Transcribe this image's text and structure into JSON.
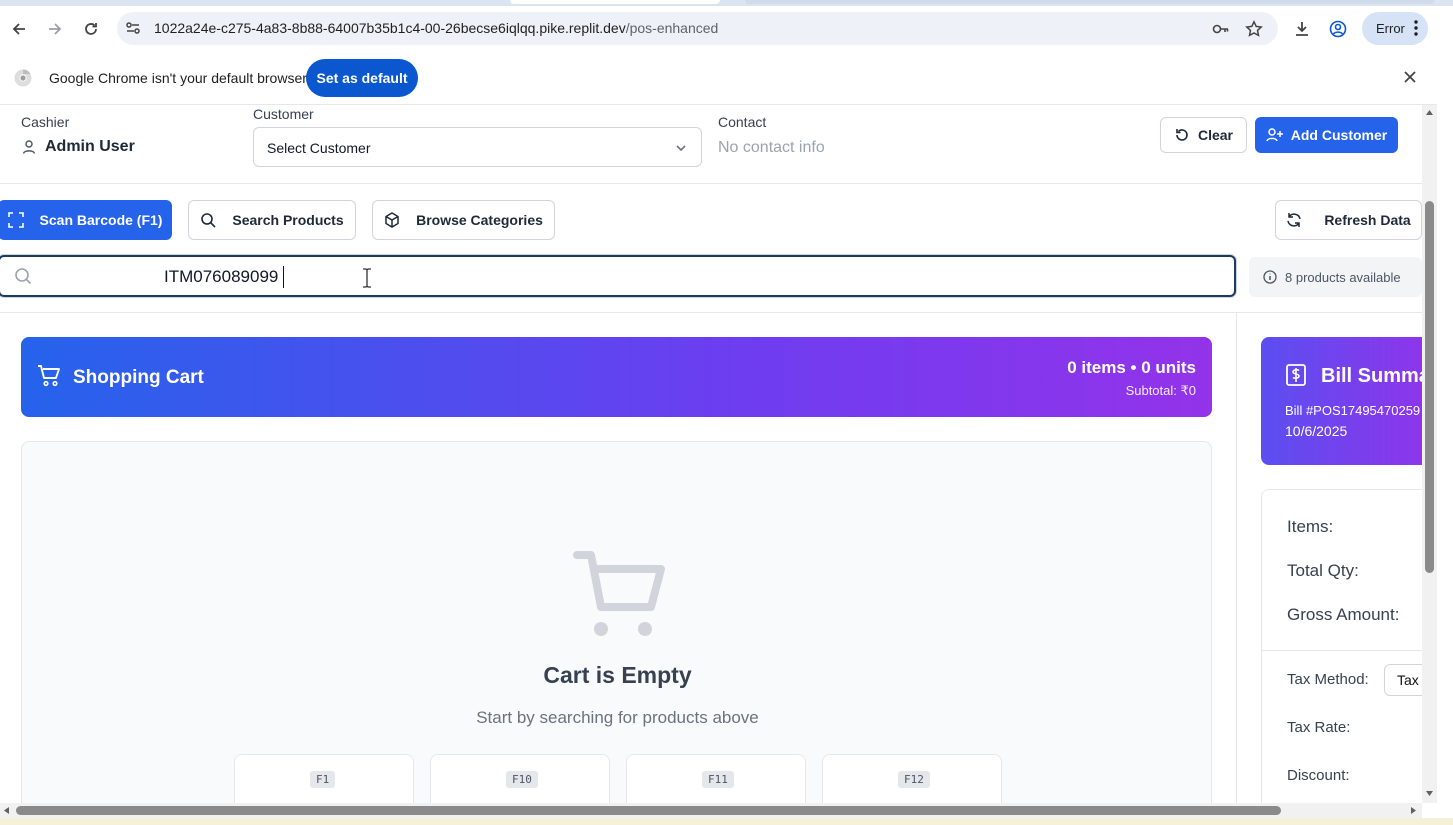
{
  "browser": {
    "url_host": "1022a24e-c275-4a83-8b88-64007b35b1c4-00-26becse6iqlqq.pike.replit.dev",
    "url_path": "/pos-enhanced",
    "profile_chip": "Error",
    "infobar_message": "Google Chrome isn't your default browser",
    "infobar_button": "Set as default"
  },
  "header": {
    "cashier_label": "Cashier",
    "cashier_name": "Admin User",
    "customer_label": "Customer",
    "customer_select_value": "Select Customer",
    "contact_label": "Contact",
    "contact_value": "No contact info",
    "clear_label": "Clear",
    "add_customer_label": "Add Customer"
  },
  "toolbar": {
    "scan_label": "Scan Barcode (F1)",
    "search_label": "Search Products",
    "browse_label": "Browse Categories",
    "refresh_label": "Refresh Data"
  },
  "search": {
    "value": "ITM076089099",
    "products_available": "8 products available"
  },
  "cart": {
    "title": "Shopping Cart",
    "counts": "0 items • 0 units",
    "subtotal": "Subtotal: ₹0",
    "empty_title": "Cart is Empty",
    "empty_subtitle": "Start by searching for products above",
    "shortcut_keys": [
      "F1",
      "F10",
      "F11",
      "F12"
    ]
  },
  "bill": {
    "title": "Bill Summa",
    "bill_number": "Bill #POS17495470259",
    "date": "10/6/2025",
    "items_label": "Items:",
    "total_qty_label": "Total Qty:",
    "gross_amount_label": "Gross Amount:",
    "tax_method_label": "Tax Method:",
    "tax_method_value": "Tax I",
    "tax_rate_label": "Tax Rate:",
    "discount_label": "Discount:"
  },
  "colors": {
    "primary": "#2563eb",
    "gradient_end": "#9333ea",
    "chrome_blue": "#0b57d0"
  }
}
